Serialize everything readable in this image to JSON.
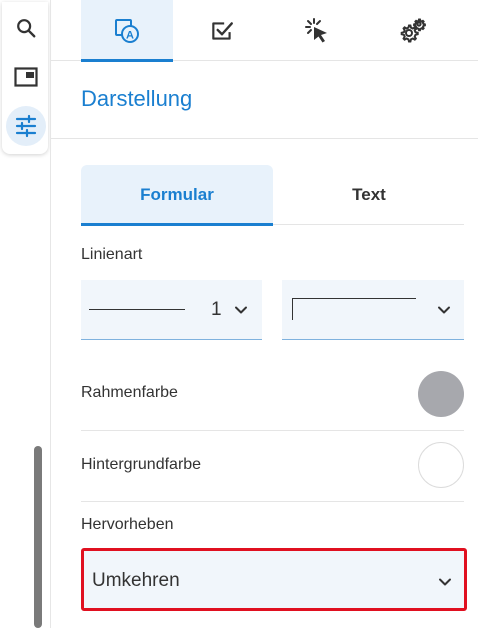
{
  "rail": {
    "items": [
      {
        "icon": "search-icon"
      },
      {
        "icon": "panel-icon"
      },
      {
        "icon": "sliders-icon",
        "active": true
      }
    ]
  },
  "tabs": [
    {
      "icon": "annotate-icon",
      "active": true
    },
    {
      "icon": "checkbox-icon"
    },
    {
      "icon": "click-icon"
    },
    {
      "icon": "gear-icon"
    }
  ],
  "section": {
    "title": "Darstellung"
  },
  "subtabs": {
    "formular": "Formular",
    "text": "Text",
    "active": "Formular"
  },
  "line_style": {
    "label": "Linienart",
    "width_value": "1"
  },
  "border_color": {
    "label": "Rahmenfarbe",
    "color": "#a7a8ad"
  },
  "background_color": {
    "label": "Hintergrundfarbe",
    "color": "#ffffff"
  },
  "highlight": {
    "label": "Hervorheben",
    "value": "Umkehren"
  },
  "colors": {
    "accent": "#1a7fd0",
    "accent_bg": "#e8f2fb",
    "focus_border": "#e01020"
  }
}
